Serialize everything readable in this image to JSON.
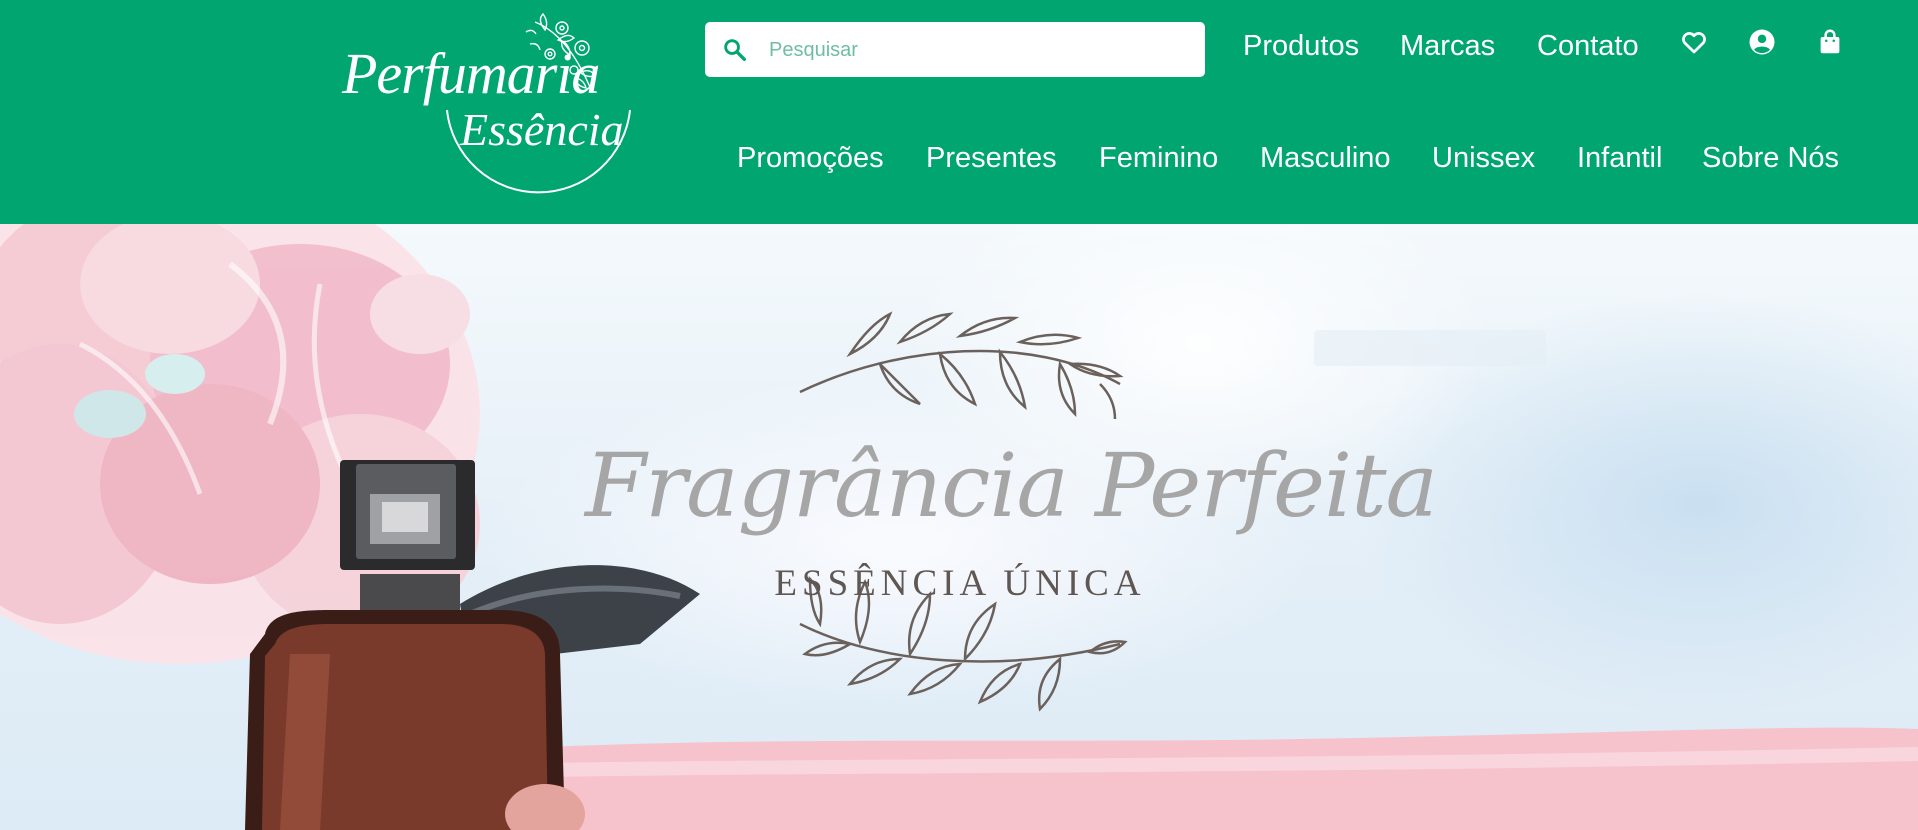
{
  "brand": {
    "name_line1": "Perfumaria",
    "name_line2": "Essência",
    "logo_icon": "floral-logo-icon",
    "color_primary": "#01a56f",
    "color_text": "#ffffff"
  },
  "search": {
    "placeholder": "Pesquisar",
    "value": "",
    "icon": "search-icon"
  },
  "top_nav": [
    "Produtos",
    "Marcas",
    "Contato"
  ],
  "header_icons": [
    "heart-icon",
    "account-icon",
    "shopping-bag-icon"
  ],
  "categories": [
    "Promoções",
    "Presentes",
    "Feminino",
    "Masculino",
    "Unissex",
    "Infantil",
    "Sobre Nós"
  ],
  "hero": {
    "title": "Fragrância Perfeita",
    "subtitle": "ESSÊNCIA ÚNICA",
    "title_color": "#a6a6a6",
    "subtitle_color": "#5f5753"
  }
}
